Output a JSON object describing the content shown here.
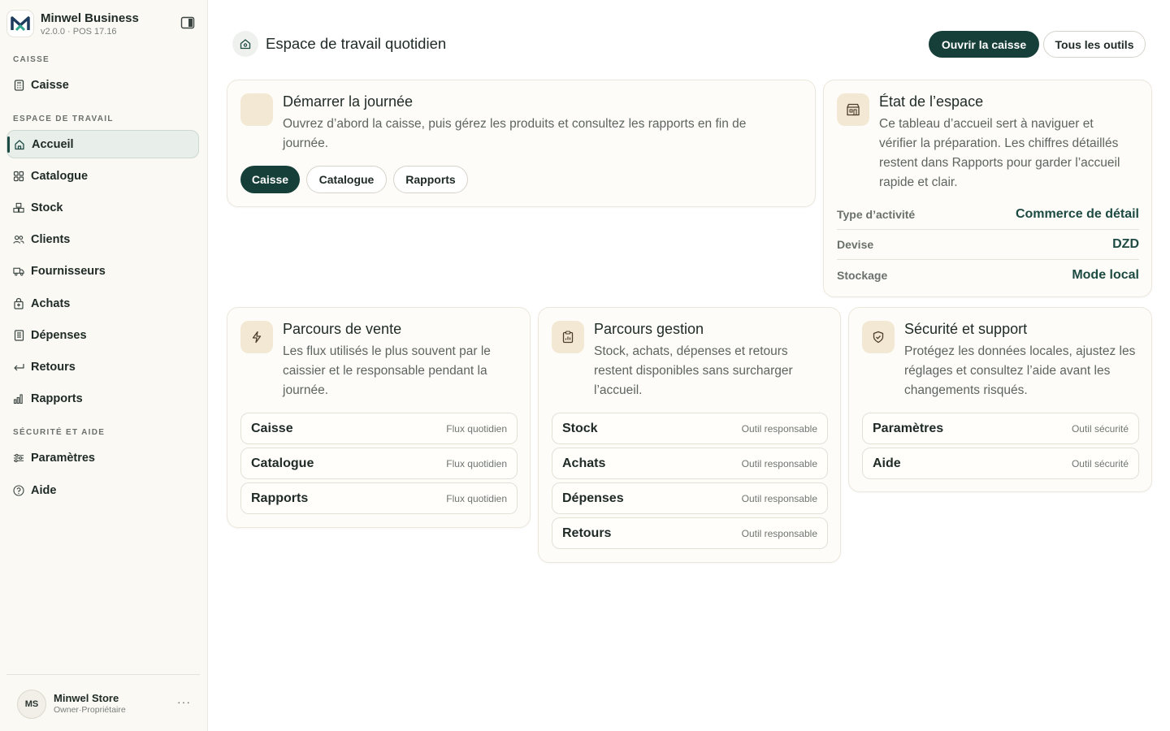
{
  "brand": {
    "name": "Minwel Business",
    "version": "v2.0.0 · POS 17.16"
  },
  "sidebar": {
    "sections": {
      "caisse": "CAISSE",
      "workspace": "ESPACE DE TRAVAIL",
      "security": "SÉCURITÉ ET AIDE"
    },
    "items": [
      {
        "label": "Caisse",
        "icon": "register-icon"
      },
      {
        "label": "Accueil",
        "icon": "home-icon",
        "active": true
      },
      {
        "label": "Catalogue",
        "icon": "grid-icon"
      },
      {
        "label": "Stock",
        "icon": "boxes-icon"
      },
      {
        "label": "Clients",
        "icon": "users-icon"
      },
      {
        "label": "Fournisseurs",
        "icon": "truck-icon"
      },
      {
        "label": "Achats",
        "icon": "bag-icon"
      },
      {
        "label": "Dépenses",
        "icon": "receipt-icon"
      },
      {
        "label": "Retours",
        "icon": "return-icon"
      },
      {
        "label": "Rapports",
        "icon": "bar-chart-icon"
      },
      {
        "label": "Paramètres",
        "icon": "sliders-icon"
      },
      {
        "label": "Aide",
        "icon": "help-icon"
      }
    ]
  },
  "user": {
    "initials": "MS",
    "name": "Minwel Store",
    "role": "Owner·Propriétaire",
    "more": "···"
  },
  "header": {
    "title": "Espace de travail quotidien",
    "primary_btn": "Ouvrir la caisse",
    "secondary_btn": "Tous les outils"
  },
  "start_card": {
    "title": "Démarrer la journée",
    "desc": "Ouvrez d’abord la caisse, puis gérez les produits et consultez les rapports en fin de journée.",
    "pills": [
      "Caisse",
      "Catalogue",
      "Rapports"
    ]
  },
  "state_card": {
    "title": "État de l’espace",
    "desc": "Ce tableau d’accueil sert à naviguer et vérifier la préparation. Les chiffres détaillés restent dans Rapports pour garder l’accueil rapide et clair.",
    "rows": [
      {
        "key": "Type d’activité",
        "value": "Commerce de détail"
      },
      {
        "key": "Devise",
        "value": "DZD"
      },
      {
        "key": "Stockage",
        "value": "Mode local"
      }
    ]
  },
  "sales_card": {
    "title": "Parcours de vente",
    "desc": "Les flux utilisés le plus souvent par le caissier et le responsable pendant la journée.",
    "tools": [
      {
        "name": "Caisse",
        "tag": "Flux quotidien"
      },
      {
        "name": "Catalogue",
        "tag": "Flux quotidien"
      },
      {
        "name": "Rapports",
        "tag": "Flux quotidien"
      }
    ]
  },
  "manage_card": {
    "title": "Parcours gestion",
    "desc": "Stock, achats, dépenses et retours restent disponibles sans surcharger l’accueil.",
    "tools": [
      {
        "name": "Stock",
        "tag": "Outil responsable"
      },
      {
        "name": "Achats",
        "tag": "Outil responsable"
      },
      {
        "name": "Dépenses",
        "tag": "Outil responsable"
      },
      {
        "name": "Retours",
        "tag": "Outil responsable"
      }
    ]
  },
  "security_card": {
    "title": "Sécurité et support",
    "desc": "Protégez les données locales, ajustez les réglages et consultez l’aide avant les changements risqués.",
    "tools": [
      {
        "name": "Paramètres",
        "tag": "Outil sécurité"
      },
      {
        "name": "Aide",
        "tag": "Outil sécurité"
      }
    ]
  },
  "colors": {
    "accent": "#173f39",
    "icon_bg": "#f3e8d4",
    "sidebar_bg": "#faf9f4"
  }
}
